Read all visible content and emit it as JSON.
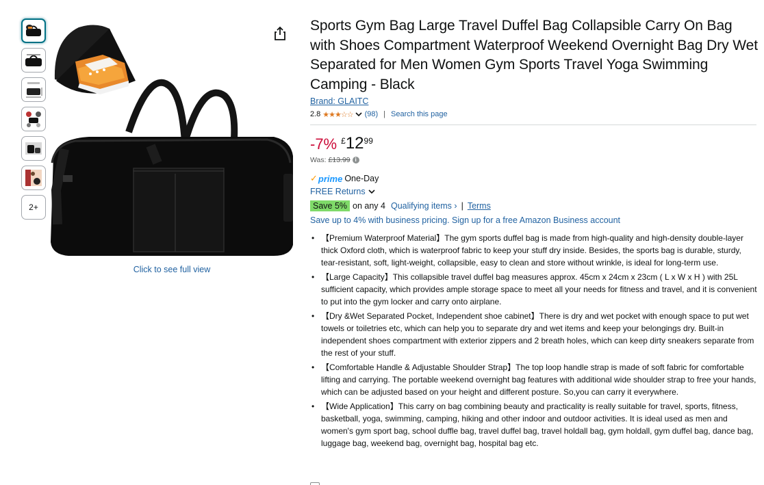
{
  "gallery": {
    "thumbnails": [
      "bag-with-shoe-compartment",
      "bag-black-front",
      "bag-size-diagram",
      "bag-features",
      "bag-in-use",
      "bag-lifestyle"
    ],
    "more_label": "2+",
    "full_view_label": "Click to see full view"
  },
  "product": {
    "title": "Sports Gym Bag Large Travel Duffel Bag Collapsible Carry On Bag with Shoes Compartment Waterproof Weekend Overnight Bag Dry Wet Separated for Men Women Gym Sports Travel Yoga Swimming Camping - Black",
    "brand": "Brand: GLAITC",
    "rating": "2.8",
    "stars": "★★★☆☆",
    "review_count": "(98)",
    "search_page": "Search this page"
  },
  "price": {
    "discount": "-7%",
    "currency": "£",
    "whole": "12",
    "fraction": "99",
    "was_label": "Was:",
    "was_price": "£13.99"
  },
  "delivery": {
    "prime_label": "prime",
    "prime_speed": "One-Day",
    "returns": "FREE Returns"
  },
  "promo": {
    "badge": "Save 5%",
    "on_any": "on any 4",
    "qualifying": "Qualifying items ›",
    "separator": "|",
    "terms": "Terms",
    "business": "Save up to 4% with business pricing. Sign up for a free Amazon Business account"
  },
  "bullets": [
    "【Premium Waterproof Material】The gym sports duffel bag is made from high-quality and high-density double-layer thick Oxford cloth, which is waterproof fabric to keep your stuff dry inside. Besides, the sports bag is durable, sturdy, tear-resistant, soft, light-weight, collapsible, easy to clean and store without wrinkle, is ideal for long-term use.",
    "【Large Capacity】This collapsible travel duffel bag measures approx. 45cm x 24cm x 23cm ( L x W x H ) with 25L sufficient capacity, which provides ample storage space to meet all your needs for fitness and travel, and it is convenient to put into the gym locker and carry onto airplane.",
    "【Dry &Wet Separated Pocket, Independent shoe cabinet】There is dry and wet pocket with enough space to put wet towels or toiletries etc, which can help you to separate dry and wet items and keep your belongings dry. Built-in independent shoes compartment with exterior zippers and 2 breath holes, which can keep dirty sneakers separate from the rest of your stuff.",
    "【Comfortable Handle & Adjustable Shoulder Strap】The top loop handle strap is made of soft fabric for comfortable lifting and carrying. The portable weekend overnight bag features with additional wide shoulder strap to free your hands, which can be adjusted based on your height and different posture. So,you can carry it everywhere.",
    "【Wide Application】This carry on bag combining beauty and practicality is really suitable for travel, sports, fitness, basketball, yoga, swimming, camping, hiking and other indoor and outdoor activities. It is ideal used as men and women's gym sport bag, school duffle bag, travel duffel bag, travel holdall bag, gym holdall, gym duffel bag, dance bag, luggage bag, weekend bag, overnight bag, hospital bag etc."
  ],
  "colors": {
    "link": "#2162a1",
    "deal_red": "#cc0c39",
    "save_green": "#7fda69",
    "star_orange": "#de7921"
  }
}
